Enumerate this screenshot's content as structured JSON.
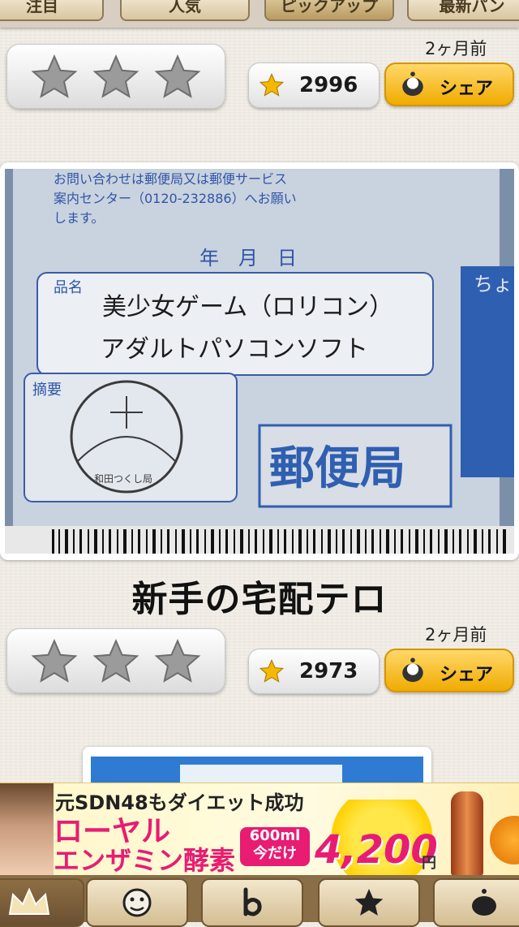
{
  "top_tabs": [
    {
      "label": "注目"
    },
    {
      "label": "人気"
    },
    {
      "label": "ピックアップ"
    },
    {
      "label": "最新パン"
    }
  ],
  "posts": [
    {
      "time": "2ヶ月前",
      "count": "2996",
      "share_label": "シェア"
    },
    {
      "title": "新手の宅配テロ",
      "time": "2ヶ月前",
      "count": "2973",
      "share_label": "シェア",
      "photo_texts": {
        "header": "お問い合わせは郵便局又は郵便サービス",
        "header2": "案内センター（0120-232886）へお願い",
        "header3": "します。",
        "date": "年　月　日",
        "item_label": "品名",
        "item_line1": "美少女ゲーム（ロリコン）",
        "item_line2": "アダルトパソコンソフト",
        "note_label": "摘要",
        "post_office": "郵便局",
        "side_vertical": "ちょう付用",
        "stamp_text": "和田つくし局"
      }
    }
  ],
  "ad": {
    "line1": "元SDN48もダイエット成功",
    "line2": "ローヤル",
    "line3": "エンザミン酵素",
    "tag": "600ml 今だけ",
    "price": "4,200",
    "yen": "円"
  },
  "bottom_tabs": [
    {
      "icon": "crown-icon"
    },
    {
      "icon": "face-icon"
    },
    {
      "icon": "b-logo-icon"
    },
    {
      "icon": "star-icon"
    },
    {
      "icon": "bell-icon"
    }
  ]
}
